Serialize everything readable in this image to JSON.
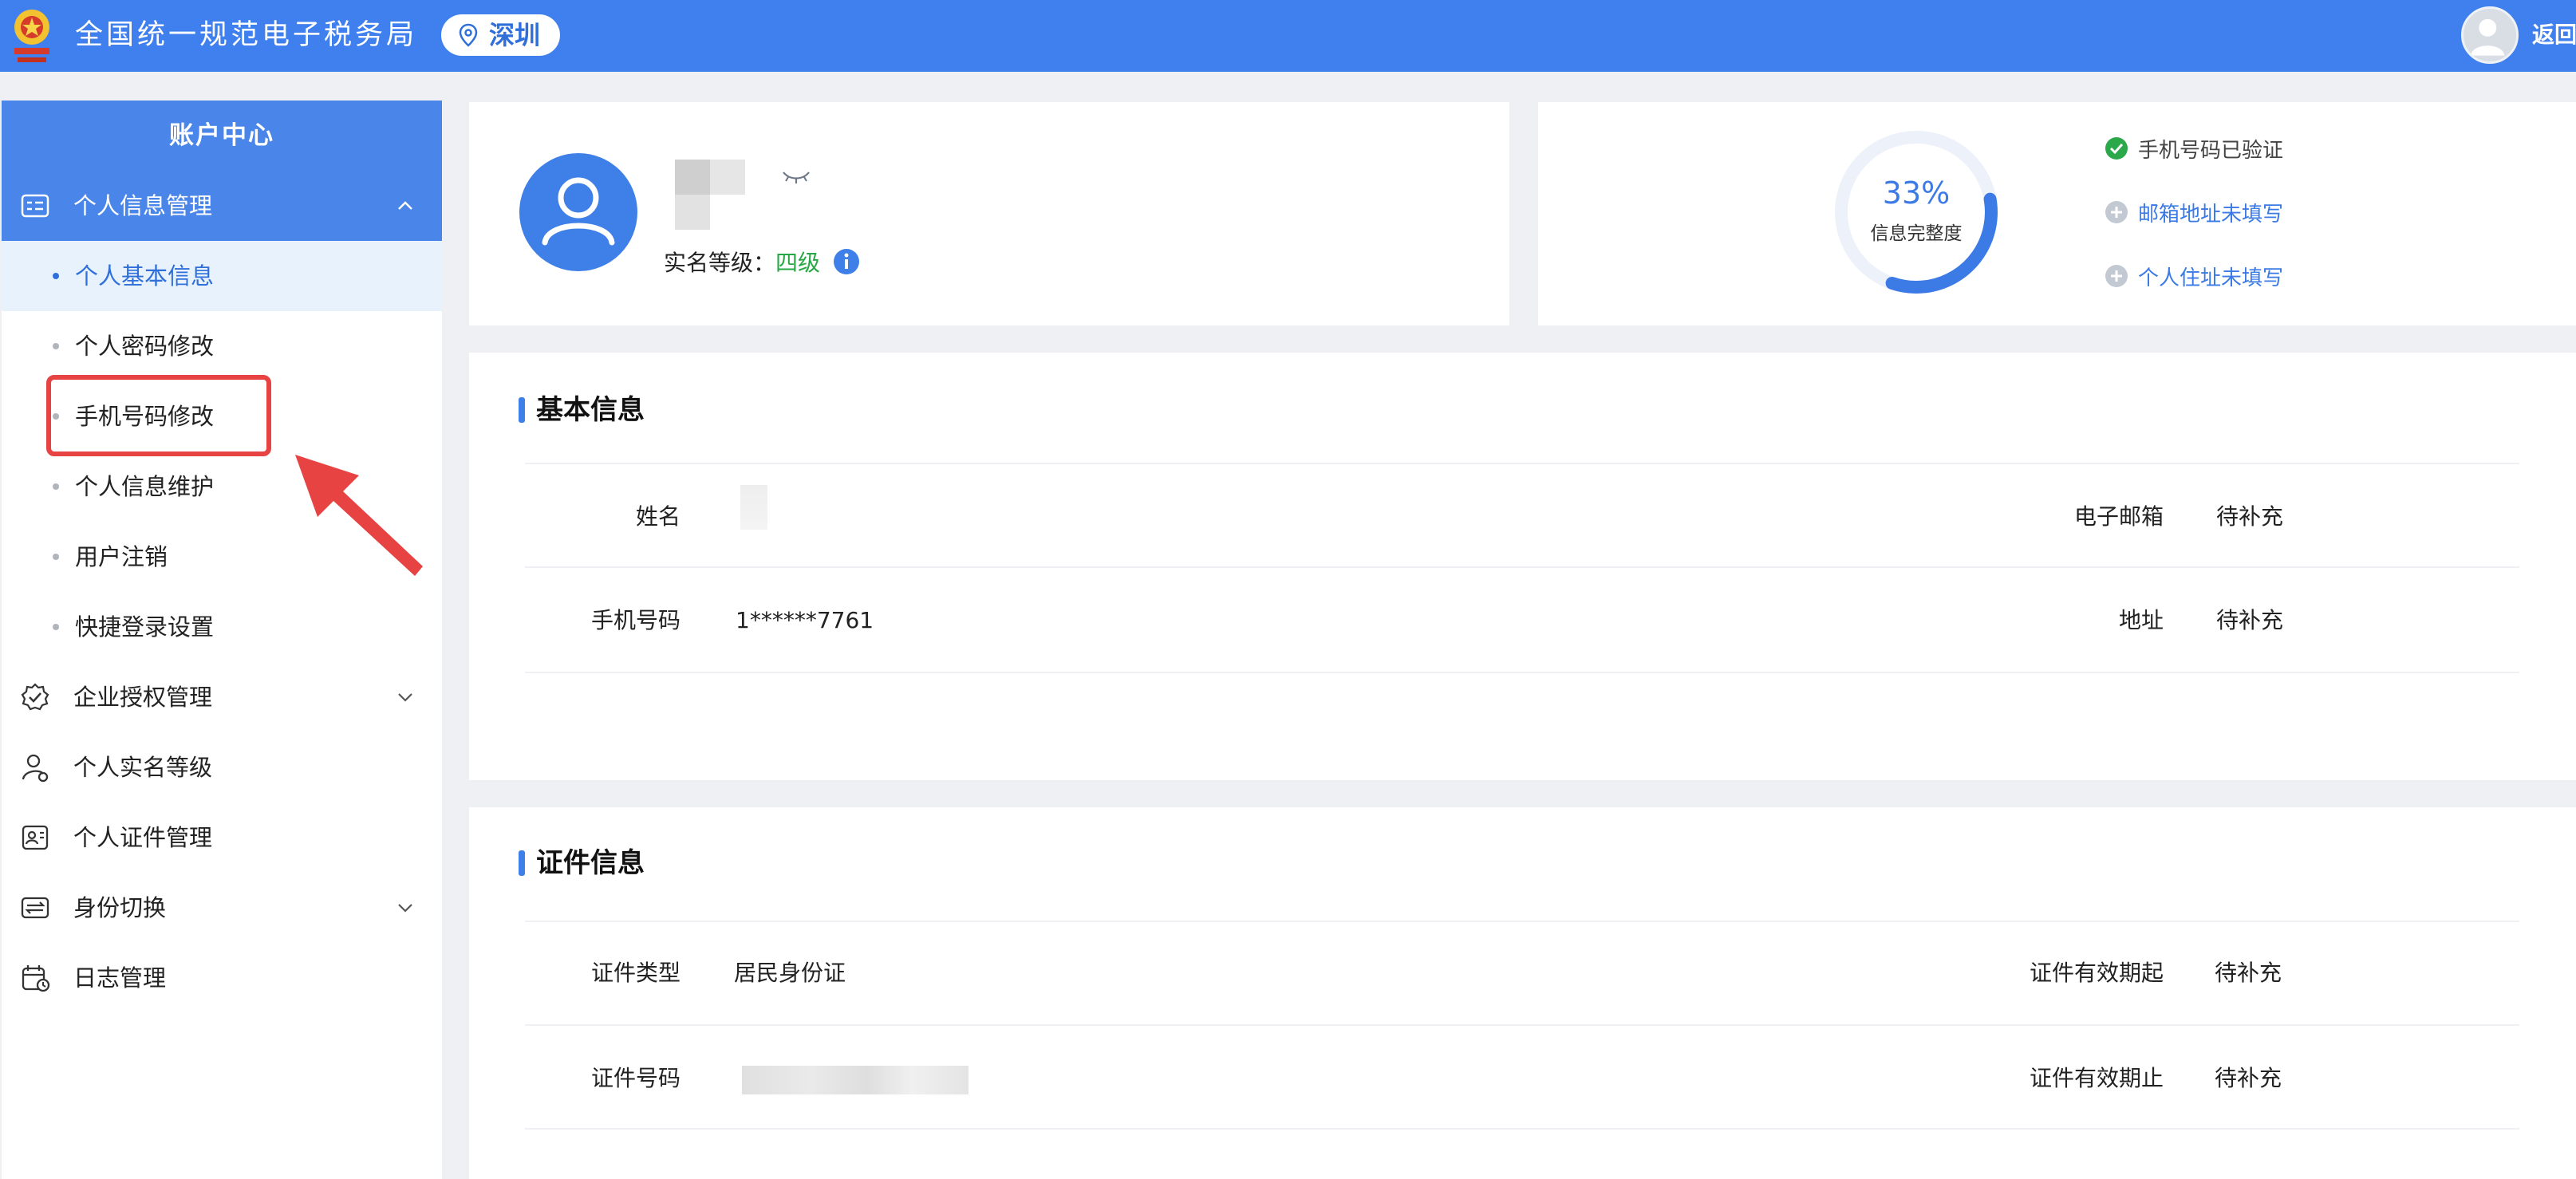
{
  "header": {
    "title": "全国统一规范电子税务局",
    "location": "深圳",
    "back": "返回",
    "emblem_icon": "tax-emblem-icon",
    "pin_icon": "location-pin-icon",
    "color": "#4080ee"
  },
  "sidebar": {
    "title": "账户中心",
    "group_active": "个人信息管理",
    "sub_items": [
      {
        "label": "个人基本信息",
        "active": true
      },
      {
        "label": "个人密码修改",
        "active": false
      },
      {
        "label": "手机号码修改",
        "active": false
      },
      {
        "label": "个人信息维护",
        "active": false
      },
      {
        "label": "用户注销",
        "active": false
      },
      {
        "label": "快捷登录设置",
        "active": false
      }
    ],
    "groups": [
      {
        "label": "企业授权管理",
        "icon": "badge-check-icon",
        "expandable": true
      },
      {
        "label": "个人实名等级",
        "icon": "user-level-icon",
        "expandable": false
      },
      {
        "label": "个人证件管理",
        "icon": "id-card-icon",
        "expandable": false
      },
      {
        "label": "身份切换",
        "icon": "switch-identity-icon",
        "expandable": true
      },
      {
        "label": "日志管理",
        "icon": "calendar-log-icon",
        "expandable": false
      }
    ]
  },
  "profile": {
    "level_label": "实名等级：",
    "level_value": "四级"
  },
  "completeness": {
    "percent_text": "33%",
    "percent": 0.33,
    "caption": "信息完整度",
    "items": {
      "verified": "手机号码已验证",
      "email": "邮箱地址未填写",
      "address": "个人住址未填写"
    }
  },
  "basic_info": {
    "title": "基本信息",
    "name_label": "姓名",
    "email_label": "电子邮箱",
    "email_value": "待补充",
    "phone_label": "手机号码",
    "phone_value": "1******7761",
    "address_label": "地址",
    "address_value": "待补充"
  },
  "cert_info": {
    "title": "证件信息",
    "type_label": "证件类型",
    "type_value": "居民身份证",
    "valid_from_label": "证件有效期起",
    "valid_from_value": "待补充",
    "number_label": "证件号码",
    "valid_to_label": "证件有效期止",
    "valid_to_value": "待补充"
  },
  "colors": {
    "accent": "#3f7fe8",
    "success": "#27a844",
    "highlight": "#e84343"
  }
}
